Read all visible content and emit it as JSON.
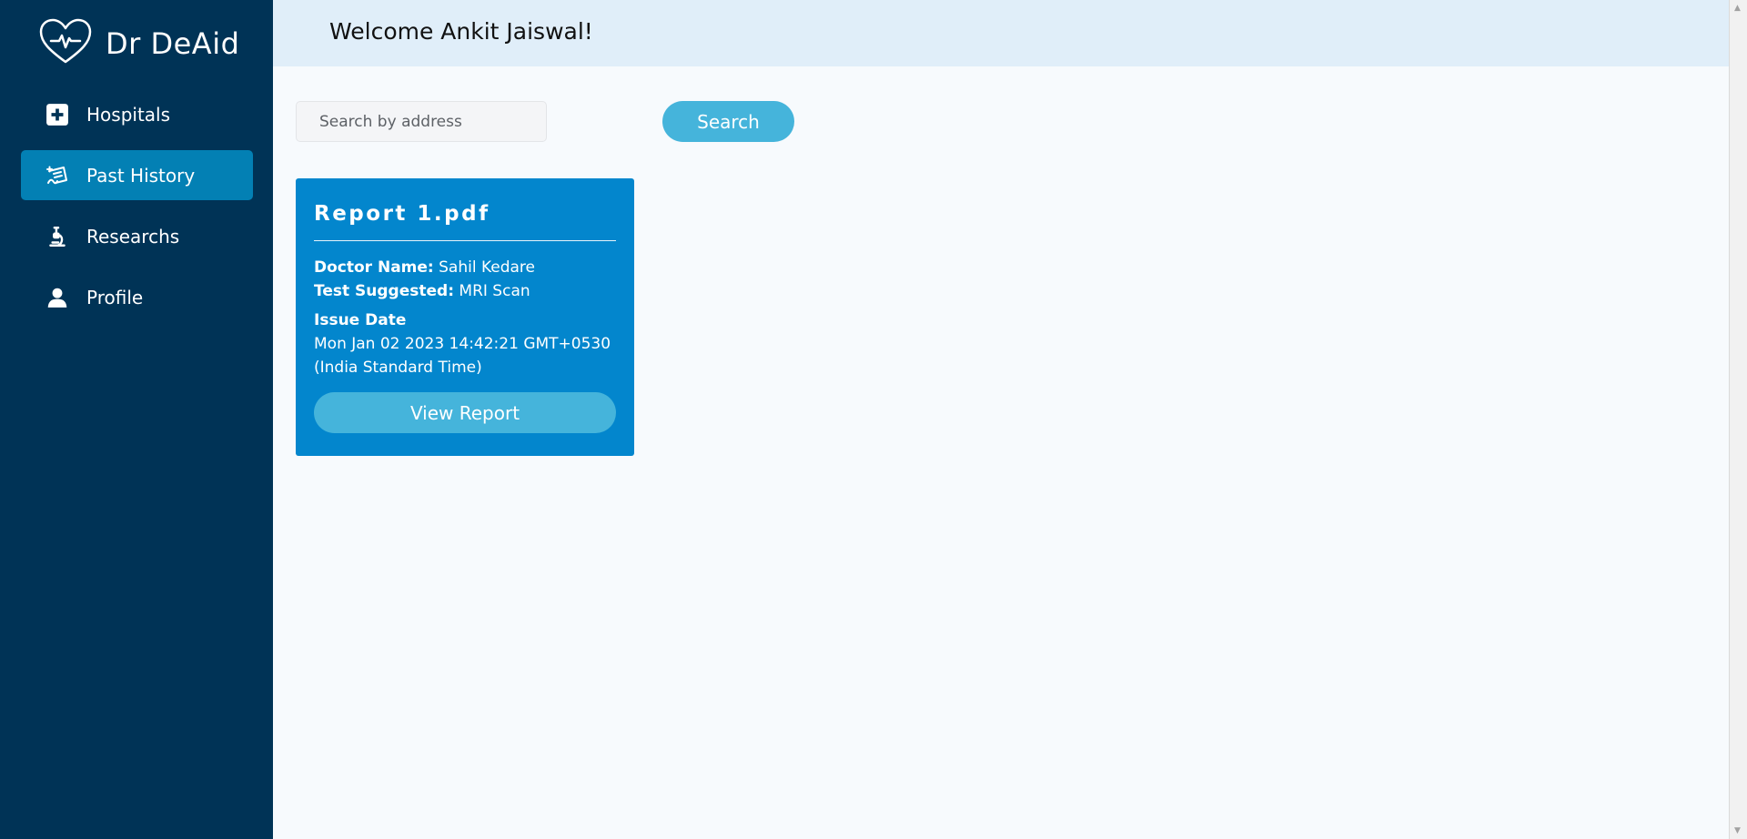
{
  "brand": {
    "name": "Dr DeAid",
    "icon": "heart-pulse-icon"
  },
  "sidebar": {
    "items": [
      {
        "label": "Hospitals",
        "icon": "hospital-plus-icon",
        "active": false
      },
      {
        "label": "Past History",
        "icon": "history-icon",
        "active": true
      },
      {
        "label": "Researchs",
        "icon": "microscope-icon",
        "active": false
      },
      {
        "label": "Profile",
        "icon": "user-icon",
        "active": false
      }
    ]
  },
  "header": {
    "welcome": "Welcome Ankit Jaiswal!"
  },
  "search": {
    "placeholder": "Search by address",
    "value": "",
    "button_label": "Search"
  },
  "reports": [
    {
      "title": "Report 1.pdf",
      "doctor_label": "Doctor Name:",
      "doctor_name": "Sahil Kedare",
      "test_label": "Test Suggested:",
      "test_value": "MRI Scan",
      "issue_label": "Issue Date",
      "issue_date": "Mon Jan 02 2023 14:42:21 GMT+0530 (India Standard Time)",
      "button_label": "View Report"
    }
  ],
  "colors": {
    "sidebar_bg": "#003356",
    "active_item": "#0380b4",
    "topbar_bg": "#e0eef9",
    "card_bg": "#0386cd",
    "button_bg": "#45b4db"
  }
}
